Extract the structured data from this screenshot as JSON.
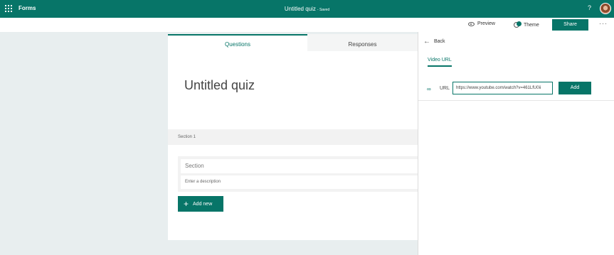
{
  "topbar": {
    "app_name": "Forms",
    "doc_title": "Untitled quiz",
    "saved_status": "- Saved",
    "help_label": "?"
  },
  "cmdbar": {
    "preview_label": "Preview",
    "theme_label": "Theme",
    "share_label": "Share",
    "more_label": "···"
  },
  "form": {
    "tabs": [
      {
        "label": "Questions",
        "active": true
      },
      {
        "label": "Responses",
        "active": false
      }
    ],
    "title": "Untitled quiz",
    "section_label": "Section 1",
    "section_title_placeholder": "Section",
    "description_placeholder": "Enter a description",
    "add_new_label": "Add new"
  },
  "panel": {
    "back_label": "Back",
    "tab_label": "Video URL",
    "url_label": "URL",
    "url_value": "https://www.youtube.com/watch?v=461LfU0ii",
    "add_label": "Add"
  },
  "colors": {
    "brand": "#077568",
    "background": "#e8eeef"
  }
}
